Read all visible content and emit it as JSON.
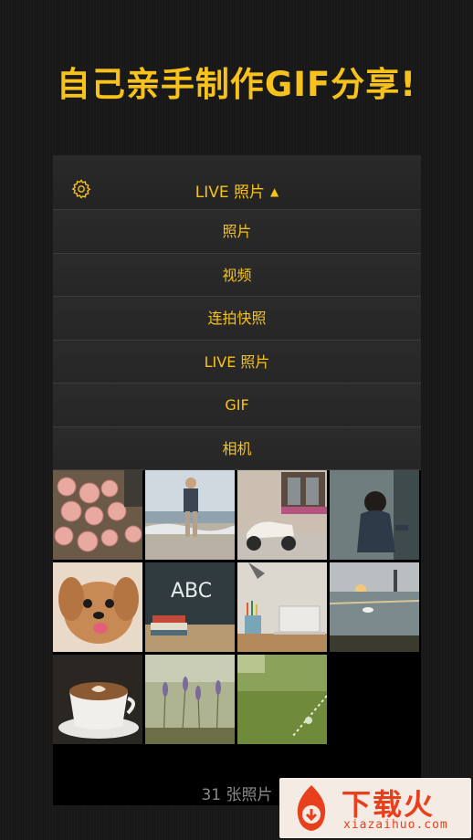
{
  "headline": "自己亲手制作GIF分享!",
  "topbar": {
    "title": "LIVE 照片",
    "caret": "▲",
    "settings_icon": "gear-icon"
  },
  "menu": {
    "items": [
      {
        "label": "照片"
      },
      {
        "label": "视频"
      },
      {
        "label": "连拍快照"
      },
      {
        "label": "LIVE 照片"
      },
      {
        "label": "GIF"
      },
      {
        "label": "相机"
      }
    ]
  },
  "gallery": {
    "thumbnails": [
      {
        "name": "roses-photo"
      },
      {
        "name": "beach-child-photo"
      },
      {
        "name": "scooter-photo"
      },
      {
        "name": "boy-photo"
      },
      {
        "name": "dog-photo"
      },
      {
        "name": "chalkboard-abc-photo",
        "text": "ABC"
      },
      {
        "name": "desk-laptop-photo"
      },
      {
        "name": "lake-swans-photo"
      },
      {
        "name": "coffee-photo"
      },
      {
        "name": "lavender-photo"
      },
      {
        "name": "grass-sprinkler-photo"
      }
    ],
    "count_text": "31 张照片"
  },
  "watermark": {
    "brand": "下载火",
    "url": "xiazaihuo.com"
  },
  "colors": {
    "accent": "#f7c21c",
    "background": "#181818",
    "bar": "#262626",
    "watermark_red": "#e8401c"
  }
}
